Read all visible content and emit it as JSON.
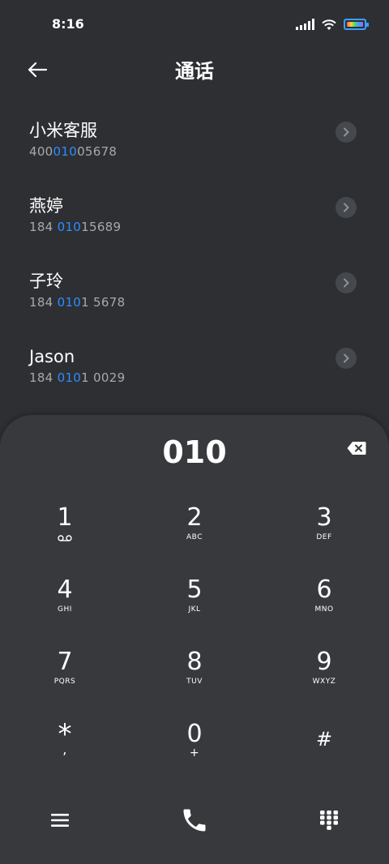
{
  "status_bar": {
    "time": "8:16"
  },
  "header": {
    "title": "通话"
  },
  "contacts": [
    {
      "name": "小米客服",
      "number_pre": "400",
      "number_match": "010",
      "number_post": "05678"
    },
    {
      "name": "燕婷",
      "number_pre": "184 ",
      "number_match": "010",
      "number_post": "15689"
    },
    {
      "name": "子玲",
      "number_pre": "184 ",
      "number_match": "010",
      "number_post": "1 5678"
    },
    {
      "name": "Jason",
      "number_pre": "184 ",
      "number_match": "010",
      "number_post": "1 0029"
    }
  ],
  "dialer": {
    "input": "010",
    "keys": [
      {
        "digit": "1",
        "letters": ""
      },
      {
        "digit": "2",
        "letters": "ABC"
      },
      {
        "digit": "3",
        "letters": "DEF"
      },
      {
        "digit": "4",
        "letters": "GHI"
      },
      {
        "digit": "5",
        "letters": "JKL"
      },
      {
        "digit": "6",
        "letters": "MNO"
      },
      {
        "digit": "7",
        "letters": "PQRS"
      },
      {
        "digit": "8",
        "letters": "TUV"
      },
      {
        "digit": "9",
        "letters": "WXYZ"
      },
      {
        "digit": "*",
        "letters": ","
      },
      {
        "digit": "0",
        "letters": "+"
      },
      {
        "digit": "#",
        "letters": ""
      }
    ]
  },
  "colors": {
    "accent": "#2f8cff",
    "background": "#2d2f33",
    "panel": "#37393d"
  }
}
